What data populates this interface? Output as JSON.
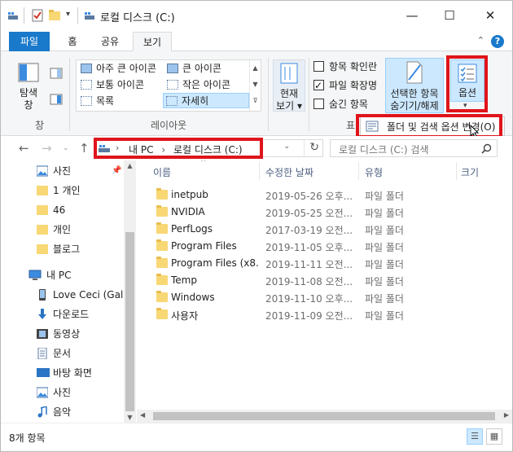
{
  "window": {
    "title": "로컬 디스크 (C:)",
    "minimize_glyph": "—",
    "maximize_glyph": "☐",
    "close_glyph": "✕"
  },
  "ribbon_tabs": [
    {
      "label": "파일"
    },
    {
      "label": "홈"
    },
    {
      "label": "공유"
    },
    {
      "label": "보기"
    }
  ],
  "ribbon": {
    "pane_group": {
      "nav_pane_line1": "탐색",
      "nav_pane_line2": "창",
      "label": "창"
    },
    "layout_group": {
      "label": "레이아웃",
      "items": [
        {
          "label": "아주 큰 아이콘"
        },
        {
          "label": "큰 아이콘"
        },
        {
          "label": "보통 아이콘"
        },
        {
          "label": "작은 아이콘"
        },
        {
          "label": "목록"
        },
        {
          "label": "자세히"
        }
      ]
    },
    "current_view": {
      "line1": "현재",
      "line2": "보기"
    },
    "show_hide": {
      "item_checkboxes": {
        "label": "항목 확인란",
        "checked": false
      },
      "file_extensions": {
        "label": "파일 확장명",
        "checked": true
      },
      "hidden_items": {
        "label": "숨긴 항목",
        "checked": false
      },
      "hide_selected_line1": "선택한 항목",
      "hide_selected_line2": "숨기기/해제",
      "group_label_partial": "표"
    },
    "options": {
      "label": "옵션"
    }
  },
  "options_menu": {
    "item": "폴더 및 검색 옵션 변경(O)"
  },
  "address": {
    "root": "내 PC",
    "separator": "›",
    "current": "로컬 디스크 (C:)"
  },
  "search": {
    "placeholder": "로컬 디스크 (C:) 검색"
  },
  "nav_pane": [
    {
      "label": "사진",
      "icon": "pictures-icon",
      "pinned": true
    },
    {
      "label": "1 개인",
      "icon": "folder-icon"
    },
    {
      "label": "46",
      "icon": "folder-icon"
    },
    {
      "label": "개인",
      "icon": "folder-icon"
    },
    {
      "label": "블로그",
      "icon": "folder-icon"
    },
    {
      "label": "내 PC",
      "icon": "computer-icon"
    },
    {
      "label": "Love Ceci (Galax",
      "icon": "phone-icon"
    },
    {
      "label": "다운로드",
      "icon": "download-icon"
    },
    {
      "label": "동영상",
      "icon": "video-icon"
    },
    {
      "label": "문서",
      "icon": "document-icon"
    },
    {
      "label": "바탕 화면",
      "icon": "desktop-icon"
    },
    {
      "label": "사진",
      "icon": "pictures-icon"
    },
    {
      "label": "음악",
      "icon": "music-icon"
    }
  ],
  "columns": {
    "name": "이름",
    "modified": "수정한 날짜",
    "type": "유형",
    "size": "크기"
  },
  "files": [
    {
      "name": "inetpub",
      "modified": "2019-05-26 오후...",
      "type": "파일 폴더"
    },
    {
      "name": "NVIDIA",
      "modified": "2019-05-25 오전...",
      "type": "파일 폴더"
    },
    {
      "name": "PerfLogs",
      "modified": "2017-03-19 오전...",
      "type": "파일 폴더"
    },
    {
      "name": "Program Files",
      "modified": "2019-11-05 오후...",
      "type": "파일 폴더"
    },
    {
      "name": "Program Files (x8...",
      "modified": "2019-11-11 오전...",
      "type": "파일 폴더"
    },
    {
      "name": "Temp",
      "modified": "2019-11-08 오전...",
      "type": "파일 폴더"
    },
    {
      "name": "Windows",
      "modified": "2019-11-10 오후...",
      "type": "파일 폴더"
    },
    {
      "name": "사용자",
      "modified": "2019-11-09 오전...",
      "type": "파일 폴더"
    }
  ],
  "status": {
    "item_count": "8개 항목"
  },
  "colors": {
    "accent": "#1979ca",
    "highlight": "#e0141b",
    "selection": "#cce8ff",
    "folder": "#f8d775"
  }
}
